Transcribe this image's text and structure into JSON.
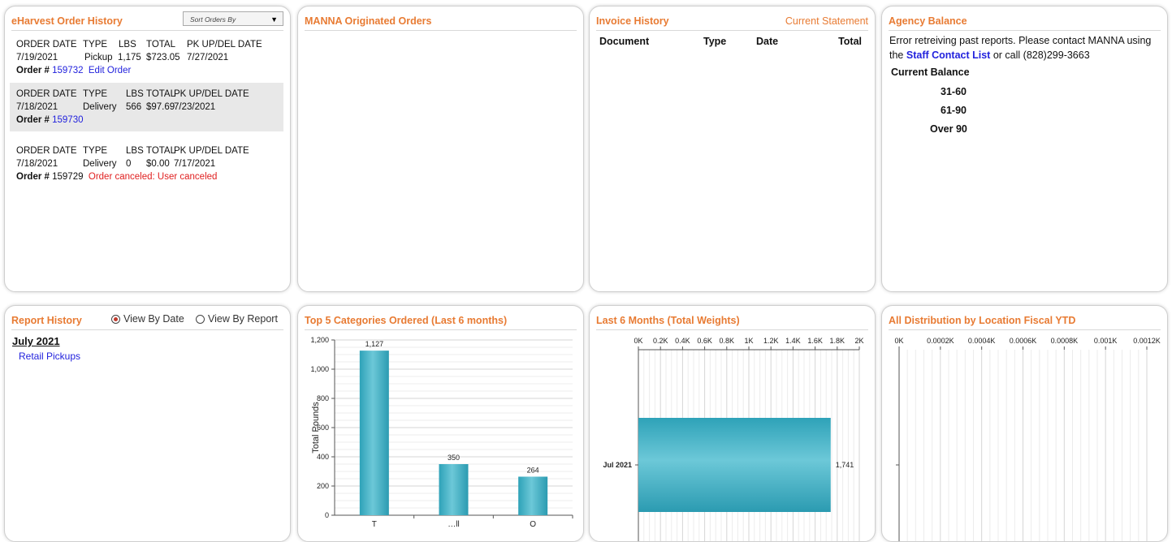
{
  "eharvest": {
    "title": "eHarvest Order History",
    "sort_placeholder": "Sort Orders By",
    "headers": {
      "date": "ORDER DATE",
      "type": "TYPE",
      "lbs": "LBS",
      "total": "TOTAL",
      "pk": "PK UP/DEL DATE"
    },
    "order_label": "Order #",
    "orders": [
      {
        "date": "7/19/2021",
        "type": "Pickup",
        "lbs": "1,175",
        "total": "$723.05",
        "pk": "7/27/2021",
        "number": "159732",
        "action": "Edit Order"
      },
      {
        "date": "7/18/2021",
        "type": "Delivery",
        "lbs": "566",
        "total": "$97.69",
        "pk": "7/23/2021",
        "number": "159730"
      },
      {
        "date": "7/18/2021",
        "type": "Delivery",
        "lbs": "0",
        "total": "$0.00",
        "pk": "7/17/2021",
        "number": "159729",
        "status": "Order canceled: User canceled"
      }
    ]
  },
  "manna": {
    "title": "MANNA Originated Orders"
  },
  "invoice": {
    "title": "Invoice History",
    "statement_link": "Current Statement",
    "columns": [
      "Document",
      "Type",
      "Date",
      "Total"
    ]
  },
  "agency": {
    "title": "Agency Balance",
    "error_text": "Error retreiving past reports. Please contact MANNA using the",
    "link_text": "Staff Contact List",
    "tail_text": "or call (828)299-3663",
    "rows": [
      "Current Balance",
      "31-60",
      "61-90",
      "Over 90"
    ]
  },
  "report": {
    "title": "Report History",
    "radio_date": "View By Date",
    "radio_report": "View By Report",
    "month": "July 2021",
    "item": "Retail Pickups"
  },
  "top5": {
    "title": "Top 5 Categories Ordered (Last 6 months)"
  },
  "last6": {
    "title": "Last 6 Months (Total Weights)"
  },
  "distribution": {
    "title": "All Distribution by Location Fiscal YTD"
  },
  "colors": {
    "accent": "#e87b33",
    "bar": "#3fb0c4",
    "link": "#2222dd",
    "error": "#e02020"
  },
  "chart_data": [
    {
      "type": "bar",
      "ylabel": "Total Pounds",
      "categories": [
        "T",
        "…ll",
        "O"
      ],
      "values": [
        1127,
        350,
        264
      ],
      "data_labels": [
        "1,127",
        "350",
        "264"
      ],
      "y_ticks": [
        "0",
        "200",
        "400",
        "600",
        "800",
        "1,000",
        "1,200"
      ],
      "ylim": [
        0,
        1200
      ],
      "grid": true
    },
    {
      "type": "bar",
      "orientation": "horizontal",
      "categories": [
        "Jul 2021"
      ],
      "values": [
        1741
      ],
      "data_labels": [
        "1,741"
      ],
      "x_ticks": [
        "0K",
        "0.2K",
        "0.4K",
        "0.6K",
        "0.8K",
        "1K",
        "1.2K",
        "1.4K",
        "1.6K",
        "1.8K",
        "2K"
      ],
      "xlim": [
        0,
        2000
      ],
      "grid": true
    },
    {
      "type": "bar",
      "orientation": "horizontal",
      "categories": [],
      "values": [],
      "x_ticks": [
        "0K",
        "0.0002K",
        "0.0004K",
        "0.0006K",
        "0.0008K",
        "0.001K",
        "0.0012K"
      ],
      "grid": true
    }
  ]
}
